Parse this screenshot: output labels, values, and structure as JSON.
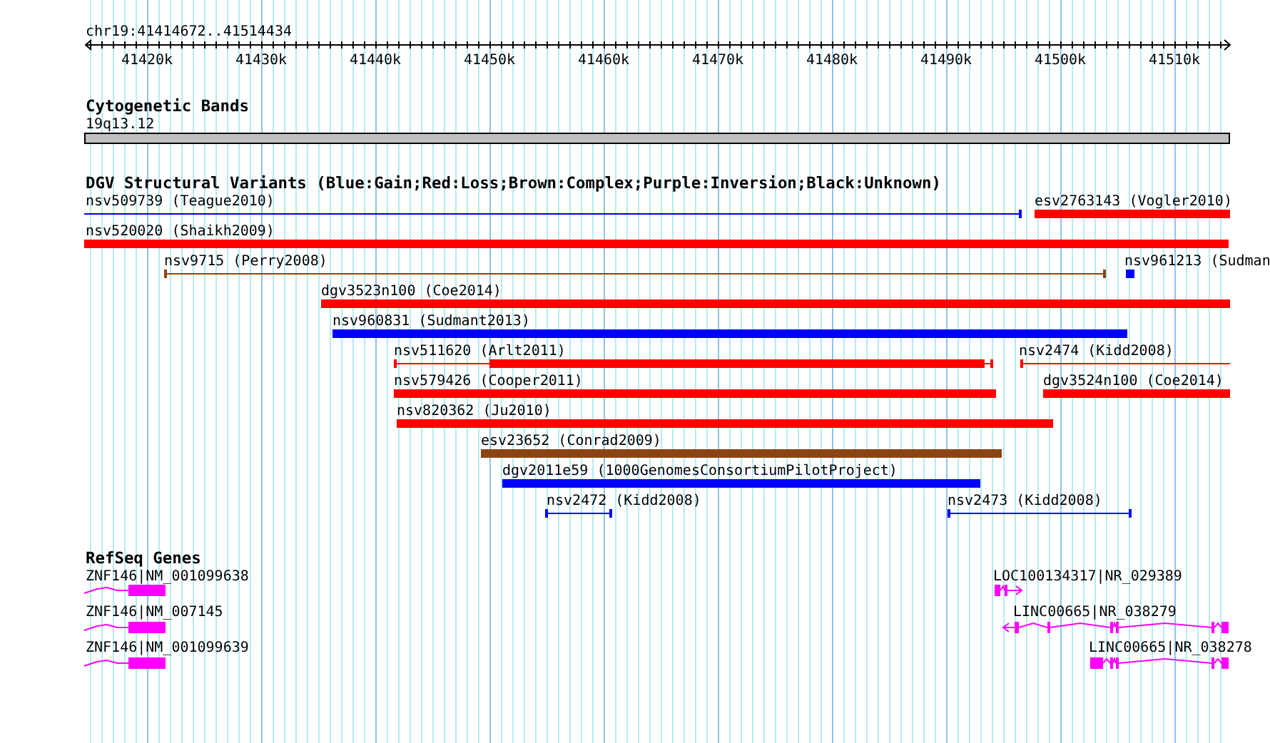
{
  "ruler": {
    "location": "chr19:41414672..41514434",
    "ticks": [
      "41420k",
      "41430k",
      "41440k",
      "41450k",
      "41460k",
      "41470k",
      "41480k",
      "41490k",
      "41500k",
      "41510k"
    ]
  },
  "tracks": [
    {
      "kind": "cytoband",
      "title": "Cytogenetic Bands",
      "features": [
        {
          "label": "19q13.12"
        }
      ]
    },
    {
      "kind": "variants",
      "title": "DGV Structural Variants (Blue:Gain;Red:Loss;Brown:Complex;Purple:Inversion;Black:Unknown)",
      "features": [
        {
          "label": "nsv509739 (Teague2010)",
          "color": "#0000ff",
          "kind": "line"
        },
        {
          "label": "esv2763143 (Vogler2010)",
          "color": "#ff0000",
          "kind": "bar"
        },
        {
          "label": "nsv520020 (Shaikh2009)",
          "color": "#ff0000",
          "kind": "bar"
        },
        {
          "label": "nsv9715 (Perry2008)",
          "color": "#8b4513",
          "kind": "line"
        },
        {
          "label": "nsv961213 (Sudman",
          "color": "#0000ff",
          "kind": "bar"
        },
        {
          "label": "dgv3523n100 (Coe2014)",
          "color": "#ff0000",
          "kind": "bar"
        },
        {
          "label": "nsv960831 (Sudmant2013)",
          "color": "#0000ff",
          "kind": "bar"
        },
        {
          "label": "nsv511620 (Arlt2011)",
          "color": "#ff0000",
          "kind": "mixed"
        },
        {
          "label": "nsv2474 (Kidd2008)",
          "color": "#ff0000",
          "kind": "line"
        },
        {
          "label": "nsv579426 (Cooper2011)",
          "color": "#ff0000",
          "kind": "bar"
        },
        {
          "label": "dgv3524n100 (Coe2014)",
          "color": "#ff0000",
          "kind": "bar"
        },
        {
          "label": "nsv820362 (Ju2010)",
          "color": "#ff0000",
          "kind": "bar"
        },
        {
          "label": "esv23652 (Conrad2009)",
          "color": "#8b4513",
          "kind": "bar"
        },
        {
          "label": "dgv2011e59 (1000GenomesConsortiumPilotProject)",
          "color": "#0000ff",
          "kind": "bar"
        },
        {
          "label": "nsv2472 (Kidd2008)",
          "color": "#0000ff",
          "kind": "line"
        },
        {
          "label": "nsv2473 (Kidd2008)",
          "color": "#0000ff",
          "kind": "line"
        }
      ]
    },
    {
      "kind": "genes",
      "title": "RefSeq Genes",
      "features": [
        {
          "label": "ZNF146|NM_001099638"
        },
        {
          "label": "ZNF146|NM_007145"
        },
        {
          "label": "ZNF146|NM_001099639"
        },
        {
          "label": "LOC100134317|NR_029389"
        },
        {
          "label": "LINC00665|NR_038279"
        },
        {
          "label": "LINC00665|NR_038278"
        }
      ]
    }
  ]
}
